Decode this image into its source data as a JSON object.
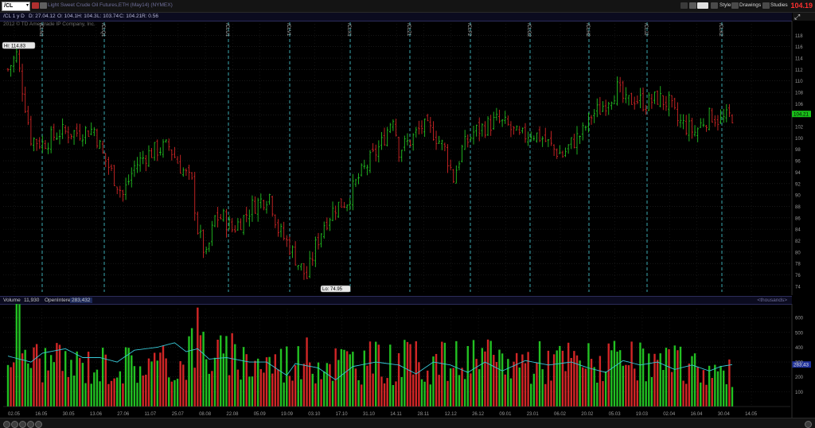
{
  "toolbar": {
    "symbol": "/CL",
    "description": "Light Sweet Crude Oil Futures,ETH (May14) (NYMEX)",
    "style_label": "Style",
    "drawings_label": "Drawings",
    "studies_label": "Studies",
    "last_price": "104.19"
  },
  "info": {
    "aggregation": "/CL 1 y D",
    "date": "D: 27.04.12",
    "open": "O: 104.1",
    "high": "H: 104.3",
    "low": "L: 103.74",
    "close": "C: 104.21",
    "range": "R: 0.56"
  },
  "copyright": "2012 © TD Ameritrade IP Company, Inc.",
  "volume_header": {
    "volume_label": "Volume",
    "volume_value": "11,930",
    "oi_label": "OpenInterest",
    "oi_value": "283,432",
    "units": "<thousands>"
  },
  "colors": {
    "up": "#22c022",
    "down": "#d12626",
    "oi_line": "#37c8d6",
    "expiration": "#3aa8b0",
    "axis_text": "#9a9a9a"
  },
  "chart_data": [
    {
      "type": "candlestick",
      "ylim": [
        73,
        120
      ],
      "yticks": [
        74,
        76,
        78,
        80,
        82,
        84,
        86,
        88,
        90,
        92,
        94,
        96,
        98,
        100,
        102,
        104,
        106,
        108,
        110,
        112,
        114,
        116,
        118
      ],
      "high_annotation": "Hi: 114.83",
      "low_annotation": "Lo: 74.95",
      "high": 114.83,
      "low": 74.95,
      "last_label": "104.21",
      "last": 104.21,
      "expirations": [
        "/CLN1",
        "/CLQ1",
        "/CLU1",
        "/CLV1",
        "/CLX1",
        "/CLZ1",
        "/CLF2",
        "/CLG2",
        "/CLH2",
        "/CLJ2",
        "/CLK2",
        "/CLM2"
      ],
      "x_tick_labels": [
        "02.05",
        "16.05",
        "30.05",
        "13.06",
        "27.06",
        "11.07",
        "25.07",
        "08.08",
        "22.08",
        "05.09",
        "19.09",
        "03.10",
        "17.10",
        "31.10",
        "14.11",
        "28.11",
        "12.12",
        "26.12",
        "09.01",
        "23.01",
        "06.02",
        "20.02",
        "05.03",
        "19.03",
        "02.04",
        "16.04",
        "30.04",
        "14.05"
      ],
      "anchors": [
        [
          0,
          112
        ],
        [
          3,
          114.6
        ],
        [
          8,
          100
        ],
        [
          12,
          99
        ],
        [
          18,
          101
        ],
        [
          24,
          101
        ],
        [
          30,
          101.5
        ],
        [
          33,
          97
        ],
        [
          36,
          94
        ],
        [
          40,
          90
        ],
        [
          44,
          95
        ],
        [
          48,
          97
        ],
        [
          52,
          98
        ],
        [
          56,
          98.5
        ],
        [
          60,
          95
        ],
        [
          64,
          92
        ],
        [
          66,
          84
        ],
        [
          69,
          79
        ],
        [
          72,
          86
        ],
        [
          75,
          86
        ],
        [
          78,
          84
        ],
        [
          82,
          86
        ],
        [
          85,
          88
        ],
        [
          88,
          89
        ],
        [
          91,
          90
        ],
        [
          94,
          84
        ],
        [
          98,
          81
        ],
        [
          101,
          78
        ],
        [
          104,
          75.6
        ],
        [
          107,
          81
        ],
        [
          110,
          85
        ],
        [
          114,
          88
        ],
        [
          118,
          89
        ],
        [
          122,
          93
        ],
        [
          126,
          96
        ],
        [
          130,
          99
        ],
        [
          134,
          104
        ],
        [
          136,
          98
        ],
        [
          140,
          99.5
        ],
        [
          144,
          102
        ],
        [
          148,
          101
        ],
        [
          152,
          98
        ],
        [
          155,
          93
        ],
        [
          158,
          98
        ],
        [
          162,
          101
        ],
        [
          166,
          102
        ],
        [
          170,
          103
        ],
        [
          174,
          102
        ],
        [
          178,
          100
        ],
        [
          182,
          101
        ],
        [
          186,
          100
        ],
        [
          190,
          98
        ],
        [
          193,
          97
        ],
        [
          196,
          99
        ],
        [
          200,
          101
        ],
        [
          203,
          104
        ],
        [
          206,
          105
        ],
        [
          209,
          107
        ],
        [
          212,
          108.6
        ],
        [
          215,
          106
        ],
        [
          218,
          107
        ],
        [
          222,
          106
        ],
        [
          226,
          107
        ],
        [
          230,
          106
        ],
        [
          233,
          103
        ],
        [
          236,
          102
        ],
        [
          239,
          101
        ],
        [
          242,
          103
        ],
        [
          245,
          104
        ],
        [
          248,
          103
        ],
        [
          252,
          104
        ]
      ]
    },
    {
      "type": "bar",
      "title": "Volume",
      "ylim": [
        0,
        660
      ],
      "yticks": [
        100,
        200,
        300,
        400,
        500,
        600
      ],
      "series": [
        {
          "name": "Volume"
        },
        {
          "name": "OpenInterest",
          "last_label": "283,43",
          "last": 283.43
        }
      ],
      "volume_anchors": [
        [
          0,
          320
        ],
        [
          3,
          590
        ],
        [
          8,
          350
        ],
        [
          20,
          300
        ],
        [
          40,
          310
        ],
        [
          60,
          300
        ],
        [
          66,
          520
        ],
        [
          70,
          380
        ],
        [
          90,
          320
        ],
        [
          104,
          340
        ],
        [
          130,
          320
        ],
        [
          160,
          330
        ],
        [
          200,
          330
        ],
        [
          240,
          290
        ],
        [
          252,
          230
        ]
      ],
      "oi_anchors": [
        [
          0,
          340
        ],
        [
          4,
          320
        ],
        [
          8,
          300
        ],
        [
          12,
          360
        ],
        [
          20,
          390
        ],
        [
          26,
          330
        ],
        [
          32,
          330
        ],
        [
          38,
          300
        ],
        [
          44,
          380
        ],
        [
          52,
          400
        ],
        [
          58,
          430
        ],
        [
          62,
          370
        ],
        [
          66,
          390
        ],
        [
          70,
          320
        ],
        [
          76,
          330
        ],
        [
          84,
          300
        ],
        [
          90,
          300
        ],
        [
          97,
          210
        ],
        [
          100,
          290
        ],
        [
          108,
          260
        ],
        [
          114,
          180
        ],
        [
          120,
          270
        ],
        [
          128,
          300
        ],
        [
          136,
          280
        ],
        [
          142,
          220
        ],
        [
          148,
          300
        ],
        [
          154,
          280
        ],
        [
          160,
          230
        ],
        [
          166,
          300
        ],
        [
          172,
          240
        ],
        [
          180,
          310
        ],
        [
          188,
          280
        ],
        [
          196,
          300
        ],
        [
          202,
          260
        ],
        [
          208,
          230
        ],
        [
          214,
          310
        ],
        [
          220,
          280
        ],
        [
          226,
          300
        ],
        [
          232,
          250
        ],
        [
          238,
          280
        ],
        [
          244,
          240
        ],
        [
          248,
          270
        ],
        [
          252,
          283
        ]
      ]
    }
  ]
}
